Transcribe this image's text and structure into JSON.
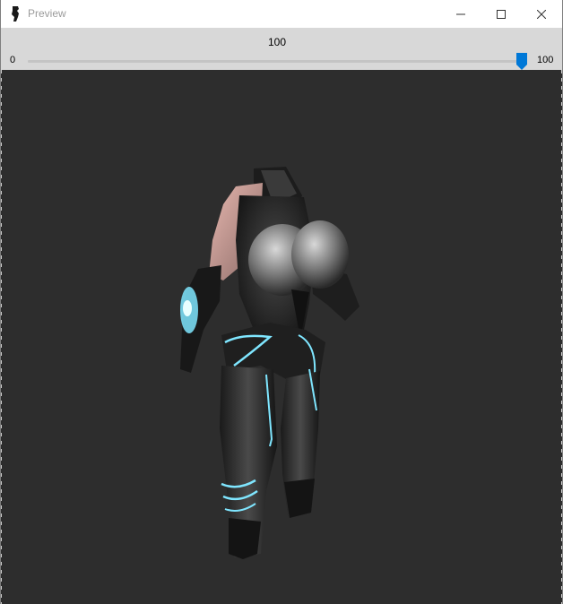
{
  "window": {
    "title": "Preview",
    "app_icon": "figure-silhouette-icon",
    "controls": [
      "minimize-icon",
      "maximize-icon",
      "close-icon"
    ]
  },
  "slider": {
    "current_value": "100",
    "value_fraction": 1.0,
    "min_label": "0",
    "max_label": "100",
    "accent_color": "#0078d7"
  },
  "viewport": {
    "background_color": "#2d2d2d",
    "model_glow_color": "#7fe6ff"
  }
}
